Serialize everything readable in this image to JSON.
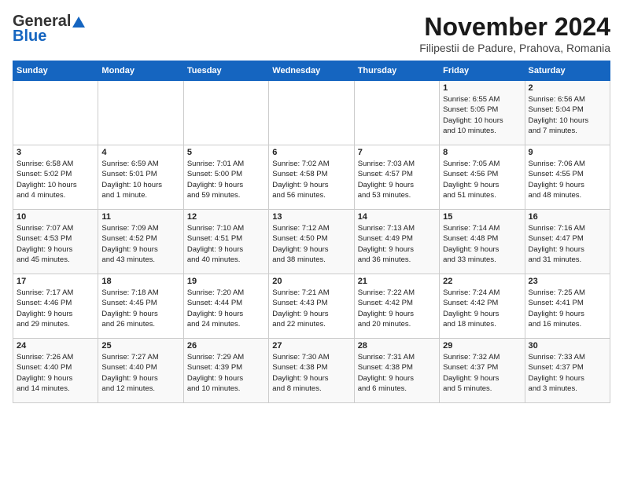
{
  "header": {
    "logo_line1": "General",
    "logo_line2": "Blue",
    "month_title": "November 2024",
    "subtitle": "Filipestii de Padure, Prahova, Romania"
  },
  "weekdays": [
    "Sunday",
    "Monday",
    "Tuesday",
    "Wednesday",
    "Thursday",
    "Friday",
    "Saturday"
  ],
  "weeks": [
    [
      {
        "day": "",
        "info": ""
      },
      {
        "day": "",
        "info": ""
      },
      {
        "day": "",
        "info": ""
      },
      {
        "day": "",
        "info": ""
      },
      {
        "day": "",
        "info": ""
      },
      {
        "day": "1",
        "info": "Sunrise: 6:55 AM\nSunset: 5:05 PM\nDaylight: 10 hours\nand 10 minutes."
      },
      {
        "day": "2",
        "info": "Sunrise: 6:56 AM\nSunset: 5:04 PM\nDaylight: 10 hours\nand 7 minutes."
      }
    ],
    [
      {
        "day": "3",
        "info": "Sunrise: 6:58 AM\nSunset: 5:02 PM\nDaylight: 10 hours\nand 4 minutes."
      },
      {
        "day": "4",
        "info": "Sunrise: 6:59 AM\nSunset: 5:01 PM\nDaylight: 10 hours\nand 1 minute."
      },
      {
        "day": "5",
        "info": "Sunrise: 7:01 AM\nSunset: 5:00 PM\nDaylight: 9 hours\nand 59 minutes."
      },
      {
        "day": "6",
        "info": "Sunrise: 7:02 AM\nSunset: 4:58 PM\nDaylight: 9 hours\nand 56 minutes."
      },
      {
        "day": "7",
        "info": "Sunrise: 7:03 AM\nSunset: 4:57 PM\nDaylight: 9 hours\nand 53 minutes."
      },
      {
        "day": "8",
        "info": "Sunrise: 7:05 AM\nSunset: 4:56 PM\nDaylight: 9 hours\nand 51 minutes."
      },
      {
        "day": "9",
        "info": "Sunrise: 7:06 AM\nSunset: 4:55 PM\nDaylight: 9 hours\nand 48 minutes."
      }
    ],
    [
      {
        "day": "10",
        "info": "Sunrise: 7:07 AM\nSunset: 4:53 PM\nDaylight: 9 hours\nand 45 minutes."
      },
      {
        "day": "11",
        "info": "Sunrise: 7:09 AM\nSunset: 4:52 PM\nDaylight: 9 hours\nand 43 minutes."
      },
      {
        "day": "12",
        "info": "Sunrise: 7:10 AM\nSunset: 4:51 PM\nDaylight: 9 hours\nand 40 minutes."
      },
      {
        "day": "13",
        "info": "Sunrise: 7:12 AM\nSunset: 4:50 PM\nDaylight: 9 hours\nand 38 minutes."
      },
      {
        "day": "14",
        "info": "Sunrise: 7:13 AM\nSunset: 4:49 PM\nDaylight: 9 hours\nand 36 minutes."
      },
      {
        "day": "15",
        "info": "Sunrise: 7:14 AM\nSunset: 4:48 PM\nDaylight: 9 hours\nand 33 minutes."
      },
      {
        "day": "16",
        "info": "Sunrise: 7:16 AM\nSunset: 4:47 PM\nDaylight: 9 hours\nand 31 minutes."
      }
    ],
    [
      {
        "day": "17",
        "info": "Sunrise: 7:17 AM\nSunset: 4:46 PM\nDaylight: 9 hours\nand 29 minutes."
      },
      {
        "day": "18",
        "info": "Sunrise: 7:18 AM\nSunset: 4:45 PM\nDaylight: 9 hours\nand 26 minutes."
      },
      {
        "day": "19",
        "info": "Sunrise: 7:20 AM\nSunset: 4:44 PM\nDaylight: 9 hours\nand 24 minutes."
      },
      {
        "day": "20",
        "info": "Sunrise: 7:21 AM\nSunset: 4:43 PM\nDaylight: 9 hours\nand 22 minutes."
      },
      {
        "day": "21",
        "info": "Sunrise: 7:22 AM\nSunset: 4:42 PM\nDaylight: 9 hours\nand 20 minutes."
      },
      {
        "day": "22",
        "info": "Sunrise: 7:24 AM\nSunset: 4:42 PM\nDaylight: 9 hours\nand 18 minutes."
      },
      {
        "day": "23",
        "info": "Sunrise: 7:25 AM\nSunset: 4:41 PM\nDaylight: 9 hours\nand 16 minutes."
      }
    ],
    [
      {
        "day": "24",
        "info": "Sunrise: 7:26 AM\nSunset: 4:40 PM\nDaylight: 9 hours\nand 14 minutes."
      },
      {
        "day": "25",
        "info": "Sunrise: 7:27 AM\nSunset: 4:40 PM\nDaylight: 9 hours\nand 12 minutes."
      },
      {
        "day": "26",
        "info": "Sunrise: 7:29 AM\nSunset: 4:39 PM\nDaylight: 9 hours\nand 10 minutes."
      },
      {
        "day": "27",
        "info": "Sunrise: 7:30 AM\nSunset: 4:38 PM\nDaylight: 9 hours\nand 8 minutes."
      },
      {
        "day": "28",
        "info": "Sunrise: 7:31 AM\nSunset: 4:38 PM\nDaylight: 9 hours\nand 6 minutes."
      },
      {
        "day": "29",
        "info": "Sunrise: 7:32 AM\nSunset: 4:37 PM\nDaylight: 9 hours\nand 5 minutes."
      },
      {
        "day": "30",
        "info": "Sunrise: 7:33 AM\nSunset: 4:37 PM\nDaylight: 9 hours\nand 3 minutes."
      }
    ]
  ]
}
